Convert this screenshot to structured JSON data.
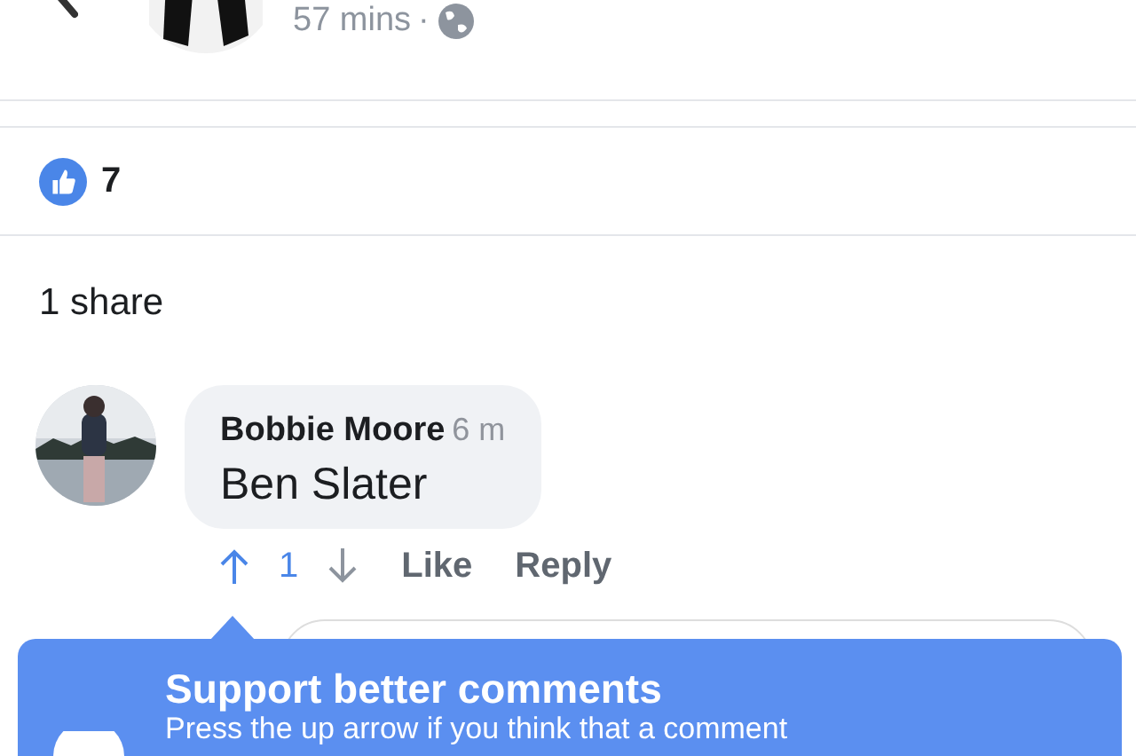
{
  "post": {
    "time": "57 mins",
    "separator": "·"
  },
  "reactions": {
    "count": "7"
  },
  "shares": "1 share",
  "comment": {
    "author": "Bobbie Moore",
    "time": "6 m",
    "text": "Ben Slater",
    "upvoted": true,
    "votes": "1",
    "actions": [
      "Like",
      "Reply"
    ]
  },
  "tooltip": {
    "title": "Support better comments",
    "body": "Press the up arrow if you think that a comment"
  }
}
